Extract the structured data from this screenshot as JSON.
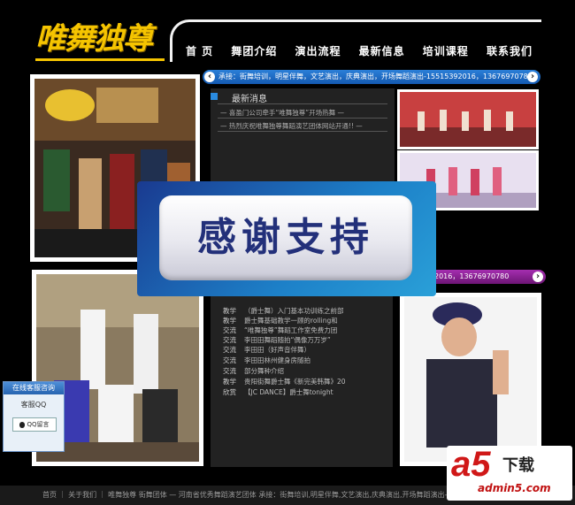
{
  "logo": {
    "text": "唯舞独尊"
  },
  "nav": [
    "首 页",
    "舞团介绍",
    "演出流程",
    "最新信息",
    "培训课程",
    "联系我们"
  ],
  "ticker_top": "承接：街舞培训，明星伴舞，文艺演出，庆典演出，开场舞蹈演出-15515392016，13676970780",
  "ticker_bottom": "2016，13676970780",
  "news": {
    "title": "最新消息",
    "items": [
      "— 喜盈门公司牵手“唯舞独尊”开场热舞 —",
      "— 热烈庆祝唯舞独尊舞蹈演艺团体网站开通!! —"
    ]
  },
  "list": [
    {
      "cat": "教学",
      "text": "（爵士舞）入门基本功训练之前部"
    },
    {
      "cat": "教学",
      "text": "爵士舞基础教学一顾的rolling和"
    },
    {
      "cat": "交流",
      "text": "“唯舞独尊”舞蹈工作室免费力团"
    },
    {
      "cat": "交流",
      "text": "李田田舞蹈随拍“偶像万万岁”"
    },
    {
      "cat": "交流",
      "text": "李田田（好声音伴舞）"
    },
    {
      "cat": "交流",
      "text": "李田田林州健身房随拍"
    },
    {
      "cat": "交流",
      "text": "部分舞种介绍"
    },
    {
      "cat": "教学",
      "text": "贵阳街舞爵士舞《新完美韩舞》20"
    },
    {
      "cat": "欣赏",
      "text": "【JC DANCE】爵士舞tonight"
    }
  ],
  "overlay": {
    "text": "感谢支持"
  },
  "qq": {
    "head": "在线客服咨询",
    "label": "客服QQ",
    "button": "QQ留言"
  },
  "footer": "首页 ｜ 关于我们 ｜ 唯舞独尊 街舞团体 — 河南省优秀舞蹈演艺团体 承接：街舞培训,明星伴舞,文艺演出,庆典演出,开场舞蹈演出-1",
  "watermark": {
    "brand": "a5",
    "download": "下载",
    "url": "admin5.com"
  },
  "colors": {
    "logo": "#f5c400",
    "ticker_blue": "#1e6fc8",
    "ticker_purple": "#8b1f96",
    "overlay": "#1d80c8"
  }
}
